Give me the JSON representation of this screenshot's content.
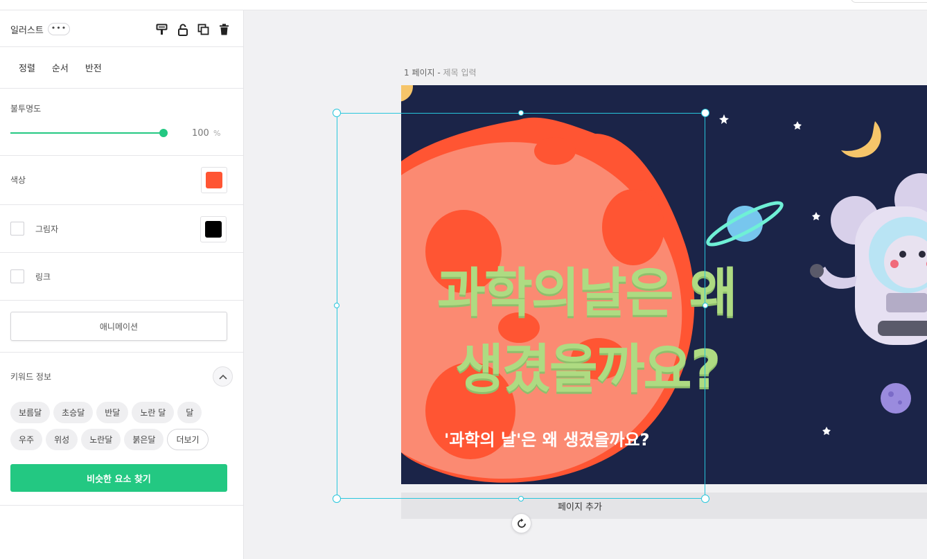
{
  "panel": {
    "title": "일러스트",
    "more_label": "•••",
    "tool_icons": [
      "paint-format-icon",
      "unlock-icon",
      "duplicate-icon",
      "trash-icon"
    ],
    "tabs": [
      "정렬",
      "순서",
      "반전"
    ],
    "opacity": {
      "label": "불투명도",
      "value": "100",
      "unit": "%",
      "fraction": 1.0
    },
    "color": {
      "label": "색상",
      "value": "#ff5533"
    },
    "shadow": {
      "label": "그림자",
      "checked": false,
      "color": "#000000"
    },
    "link": {
      "label": "링크",
      "checked": false
    },
    "animation_label": "애니메이션",
    "keywords": {
      "label": "키워드 정보",
      "tags": [
        "보름달",
        "초승달",
        "반달",
        "노란 달",
        "달",
        "우주",
        "위성",
        "노란달",
        "붉은달"
      ],
      "more_label": "더보기",
      "find_label": "비슷한 요소 찾기"
    }
  },
  "canvas": {
    "page_number": "1 페이지",
    "page_separator": " - ",
    "page_title_placeholder": "제목 입력",
    "headline_line1": "과학의날은 왜",
    "headline_line2": "생겼을까요?",
    "subtitle": "'과학의 날'은 왜 생겼을까요?",
    "add_page_label": "페이지 추가"
  },
  "colors": {
    "accent": "#23c882",
    "selection": "#27c6dc",
    "artboard_bg": "#1b2448",
    "headline": "#aedb82"
  }
}
